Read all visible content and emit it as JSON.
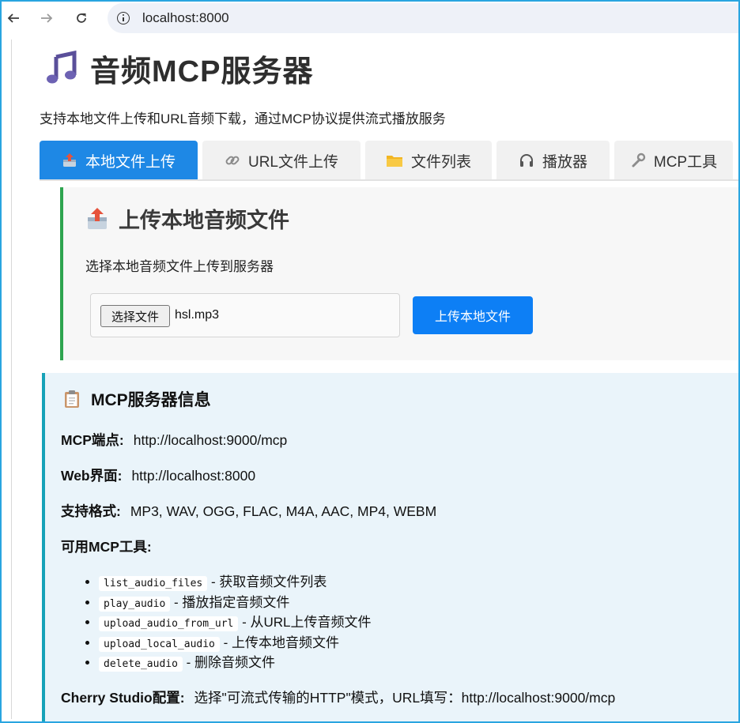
{
  "browser": {
    "url": "localhost:8000"
  },
  "page": {
    "title": "音频MCP服务器",
    "subtitle": "支持本地文件上传和URL音频下载，通过MCP协议提供流式播放服务"
  },
  "tabs": [
    {
      "label": "本地文件上传",
      "icon": "upload-tray-icon",
      "active": true
    },
    {
      "label": "URL文件上传",
      "icon": "link-icon",
      "active": false
    },
    {
      "label": "文件列表",
      "icon": "folder-icon",
      "active": false
    },
    {
      "label": "播放器",
      "icon": "headphones-icon",
      "active": false
    },
    {
      "label": "MCP工具",
      "icon": "wrench-icon",
      "active": false
    }
  ],
  "upload": {
    "heading": "上传本地音频文件",
    "description": "选择本地音频文件上传到服务器",
    "choose_file_label": "选择文件",
    "selected_file": "hsl.mp3",
    "submit_label": "上传本地文件"
  },
  "info": {
    "heading": "MCP服务器信息",
    "endpoint_label": "MCP端点:",
    "endpoint_value": "http://localhost:9000/mcp",
    "web_label": "Web界面:",
    "web_value": "http://localhost:8000",
    "formats_label": "支持格式:",
    "formats_value": "MP3, WAV, OGG, FLAC, M4A, AAC, MP4, WEBM",
    "tools_label": "可用MCP工具:",
    "tools": [
      {
        "name": "list_audio_files",
        "desc": "- 获取音频文件列表"
      },
      {
        "name": "play_audio",
        "desc": "- 播放指定音频文件"
      },
      {
        "name": "upload_audio_from_url",
        "desc": "- 从URL上传音频文件"
      },
      {
        "name": "upload_local_audio",
        "desc": "- 上传本地音频文件"
      },
      {
        "name": "delete_audio",
        "desc": "- 删除音频文件"
      }
    ],
    "cherry_label": "Cherry Studio配置:",
    "cherry_value": "选择\"可流式传输的HTTP\"模式，URL填写：http://localhost:9000/mcp"
  },
  "colors": {
    "tab_active": "#1e88e5",
    "upload_button": "#0d7ff5",
    "upload_border": "#2ea44f",
    "info_border": "#17a2b8",
    "info_background": "#eaf4fa"
  }
}
